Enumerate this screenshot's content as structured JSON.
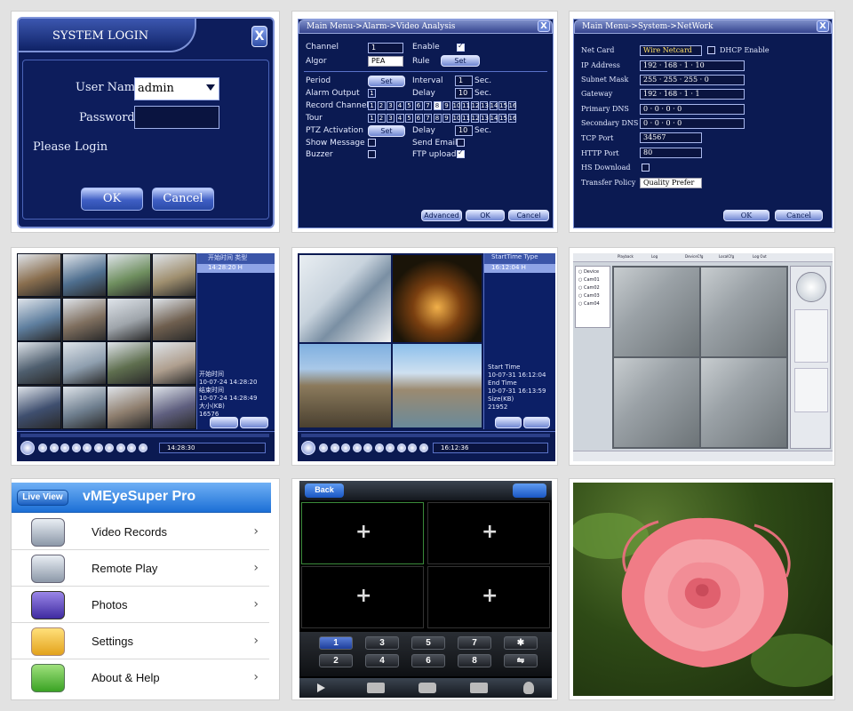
{
  "login": {
    "title": "SYSTEM LOGIN",
    "close": "X",
    "user_label": "User Name",
    "user_value": "admin",
    "password_label": "Password",
    "password_value": "",
    "status": "Please Login",
    "ok": "OK",
    "cancel": "Cancel"
  },
  "video_analysis": {
    "breadcrumb": "Main Menu->Alarm->Video Analysis",
    "close": "X",
    "channel_label": "Channel",
    "channel_value": "1",
    "enable_label": "Enable",
    "algor_label": "Algor",
    "algor_value": "PEA",
    "rule_label": "Rule",
    "set": "Set",
    "period_label": "Period",
    "interval_label": "Interval",
    "interval_value": "1",
    "sec": "Sec.",
    "alarm_output_label": "Alarm Output",
    "alarm_output_value": "1",
    "delay_label": "Delay",
    "delay_value": "10",
    "record_channel_label": "Record Channel",
    "tour_label": "Tour",
    "channel_numbers": [
      "1",
      "2",
      "3",
      "4",
      "5",
      "6",
      "7",
      "8",
      "9",
      "10",
      "11",
      "12",
      "13",
      "14",
      "15",
      "16"
    ],
    "ptz_label": "PTZ Activation",
    "delay2_value": "10",
    "show_message_label": "Show Message",
    "send_email_label": "Send Email",
    "buzzer_label": "Buzzer",
    "ftp_upload_label": "FTP upload",
    "advanced": "Advanced",
    "ok": "OK",
    "cancel": "Cancel"
  },
  "network": {
    "breadcrumb": "Main Menu->System->NetWork",
    "close": "X",
    "net_card_label": "Net Card",
    "net_card_value": "Wire Netcard",
    "dhcp_label": "DHCP Enable",
    "ip_label": "IP Address",
    "ip_value": "192 · 168 · 1 · 10",
    "subnet_label": "Subnet Mask",
    "subnet_value": "255 · 255 · 255 · 0",
    "gateway_label": "Gateway",
    "gateway_value": "192 · 168 · 1 · 1",
    "dns1_label": "Primary DNS",
    "dns1_value": "0 · 0 · 0 · 0",
    "dns2_label": "Secondary DNS",
    "dns2_value": "0 · 0 · 0 · 0",
    "tcp_label": "TCP Port",
    "tcp_value": "34567",
    "http_label": "HTTP Port",
    "http_value": "80",
    "hs_label": "HS Download",
    "transfer_label": "Transfer Policy",
    "transfer_value": "Quality Prefer",
    "ok": "OK",
    "cancel": "Cancel"
  },
  "playback16": {
    "header": "开始时间  类型",
    "first_entry": "14:28:20  H",
    "start_label": "开始时间",
    "start_value": "10-07-24 14:28:20",
    "end_label": "结束时间",
    "end_value": "10-07-24 14:28:49",
    "size_label": "大小(KB)",
    "size_value": "16576",
    "time": "14:28:30"
  },
  "playback4": {
    "header": "StartTime  Type",
    "first_entry": "16:12:04  H",
    "start_label": "Start Time",
    "start_value": "10-07-31 16:12:04",
    "end_label": "End Time",
    "end_value": "10-07-31 16:13:59",
    "size_label": "Size(KB)",
    "size_value": "21952",
    "time": "16:12:36"
  },
  "client": {
    "tabs": [
      "Playback",
      "Log",
      "DeviceCfg",
      "LocalCfg",
      "Log Out"
    ],
    "devices": [
      "Device",
      "Cam01",
      "Cam02",
      "Cam03",
      "Cam04"
    ]
  },
  "app": {
    "live_view": "Live View",
    "title": "vMEyeSuper Pro",
    "items": [
      {
        "label": "Video Records"
      },
      {
        "label": "Remote Play"
      },
      {
        "label": "Photos"
      },
      {
        "label": "Settings"
      },
      {
        "label": "About & Help"
      }
    ],
    "chevron": "›"
  },
  "phone": {
    "back": "Back",
    "add": "+",
    "keys": [
      "1",
      "3",
      "5",
      "7",
      "✱",
      "2",
      "4",
      "6",
      "8",
      "⇋"
    ]
  },
  "colors": {
    "dvr_navy": "#0b1a52",
    "ios_blue": "#2f7fe0",
    "rose": "#f0808a"
  }
}
